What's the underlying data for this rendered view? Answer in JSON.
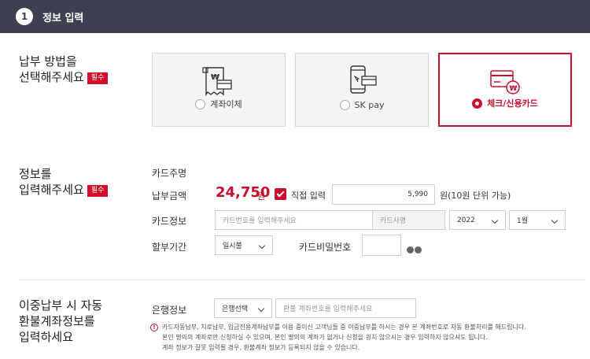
{
  "header": {
    "step": "1",
    "title": "정보 입력"
  },
  "payment_method": {
    "title_line1": "납부 방법을",
    "title_line2": "선택해주세요",
    "required": "필수",
    "options": [
      {
        "label": "계좌이체",
        "icon": "bank-transfer-icon",
        "selected": false
      },
      {
        "label": "SK pay",
        "icon": "mobile-pay-icon",
        "selected": false
      },
      {
        "label": "체크/신용카드",
        "icon": "credit-card-icon",
        "selected": true
      }
    ]
  },
  "info_input": {
    "title_line1": "정보를",
    "title_line2": "입력해주세요",
    "required": "필수",
    "card_owner_label": "카드주명",
    "amount_label": "납부금액",
    "amount_value": "24,750",
    "amount_unit": "원",
    "direct_input_label": "직접 입력",
    "direct_input_value": "5,990",
    "direct_input_hint": "원(10원 단위 가능)",
    "card_info_label": "카드정보",
    "card_number_placeholder": "카드번호를 입력해주세요",
    "card_company_placeholder": "카드사명",
    "year_value": "2022",
    "month_value": "1월",
    "installment_label": "할부기간",
    "installment_value": "일시불",
    "card_password_label": "카드비밀번호"
  },
  "refund": {
    "title_line1": "이중납부 시 자동",
    "title_line2": "환불계좌정보를",
    "title_line3": "입력하세요",
    "bank_info_label": "은행정보",
    "bank_select_value": "은행선택",
    "account_placeholder": "환불 계좌번호를 입력해주세요",
    "notice_line1": "카드자동납부, 지로납부, 입금전용계좌납부를 이용 중이신 고객님들 중 이중납부를 하시는 경우 본 계좌번호로 자동 환불처리를 해드립니다.",
    "notice_line2": "본인 명의의 계좌로만 신청하실 수 있으며, 본인 명의의 계좌가 없거나 신청을 원치 않으시는 경우 입력하지 않으셔도 됩니다.",
    "notice_line3": "계좌 정보가 잘못 입력될 경우, 환불계좌 정보가 등록되지 않을 수 있습니다."
  },
  "colors": {
    "header_bg": "#3f3f52",
    "accent": "#c8102e"
  }
}
